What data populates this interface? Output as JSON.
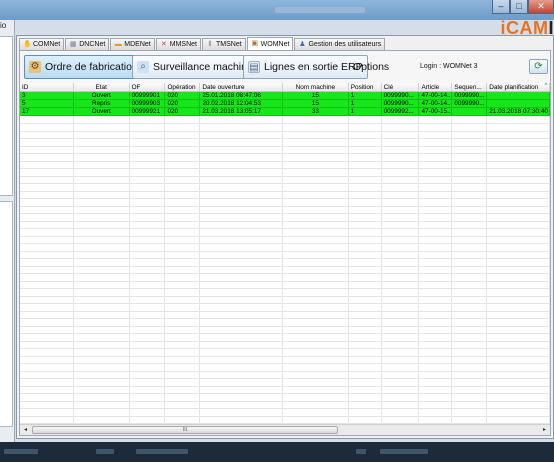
{
  "left": {
    "label": "io"
  },
  "logo": {
    "prefix": "i",
    "mid": "CAM",
    "suffix": "I"
  },
  "tabs": [
    {
      "label": "COMNet",
      "icon": "hand-icon",
      "color": "#c08a2a"
    },
    {
      "label": "DNCNet",
      "icon": "network-icon",
      "color": "#6d7f95"
    },
    {
      "label": "MDENet",
      "icon": "chart-icon",
      "color": "#e0a030"
    },
    {
      "label": "MMSNet",
      "icon": "tools-icon",
      "color": "#c84040"
    },
    {
      "label": "TMSNet",
      "icon": "drill-icon",
      "color": "#7a7a7a"
    },
    {
      "label": "WOMNet",
      "icon": "book-icon",
      "color": "#b07030"
    },
    {
      "label": "Gestion des utilisateurs",
      "icon": "users-icon",
      "color": "#3a6fb8"
    }
  ],
  "toolbar": {
    "btn_ordre": "Ordre de fabrication",
    "btn_surveillance": "Surveillance machine",
    "btn_lignes": "Lignes en sortie ERP",
    "options": "Options",
    "login": "Login : WOMNet 3"
  },
  "grid": {
    "columns": [
      "ID",
      "Etat",
      "OF",
      "Opération",
      "Date ouverture",
      "Nom machine",
      "Position",
      "Clé",
      "Article",
      "Sequen...",
      "Date planification"
    ],
    "rows": [
      [
        "3",
        "Ouvert",
        "00999901",
        "020",
        "25.01.2018 08:47:08",
        "15",
        "1",
        "0099990...",
        "47-00-14...",
        "0099990...",
        ""
      ],
      [
        "5",
        "Repris",
        "00999903",
        "020",
        "20.02.2018 12:04:53",
        "15",
        "1",
        "0099990...",
        "47-00-14...",
        "0099990...",
        ""
      ],
      [
        "17",
        "Ouvert",
        "00999921",
        "020",
        "21.03.2018 13:05:17",
        "33",
        "1",
        "0099992...",
        "47-00-15...",
        "",
        "21.03.2018 07:30:40"
      ]
    ],
    "row_color": "#17e61a",
    "hscroll_thumb": "III"
  }
}
